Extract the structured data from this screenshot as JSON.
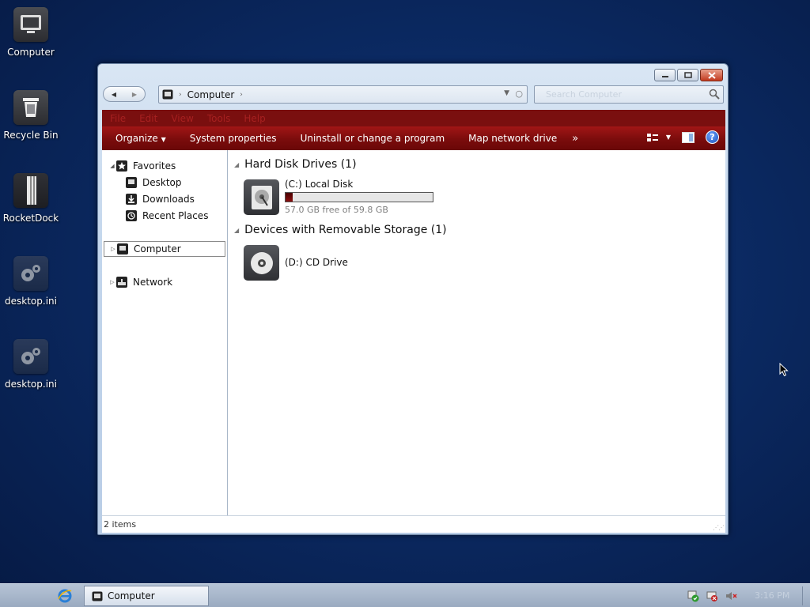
{
  "desktop": {
    "icons": [
      {
        "label": "Computer"
      },
      {
        "label": "Recycle Bin"
      },
      {
        "label": "RocketDock"
      },
      {
        "label": "desktop.ini"
      },
      {
        "label": "desktop.ini"
      }
    ]
  },
  "window": {
    "address": {
      "location": "Computer"
    },
    "search": {
      "placeholder": "Search Computer"
    },
    "menu": [
      "File",
      "Edit",
      "View",
      "Tools",
      "Help"
    ],
    "toolbar": {
      "organize": "Organize",
      "system_properties": "System properties",
      "uninstall": "Uninstall or change a program",
      "map_drive": "Map network drive",
      "more": "»",
      "help": "?"
    },
    "nav_pane": {
      "favorites": "Favorites",
      "desktop": "Desktop",
      "downloads": "Downloads",
      "recent": "Recent Places",
      "computer": "Computer",
      "network": "Network"
    },
    "content": {
      "hdd_group": "Hard Disk Drives (1)",
      "local_disk": {
        "name": "(C:) Local Disk",
        "free_text": "57.0 GB free of 59.8 GB",
        "used_fraction": 0.047
      },
      "removable_group": "Devices with Removable Storage (1)",
      "cd_drive": {
        "name": "(D:) CD Drive"
      }
    },
    "status": {
      "items": "2 items"
    }
  },
  "taskbar": {
    "task_label": "Computer",
    "clock": "3:16 PM"
  },
  "colors": {
    "accent_red": "#8a0f0f",
    "desktop_blue": "#0b2a63"
  }
}
